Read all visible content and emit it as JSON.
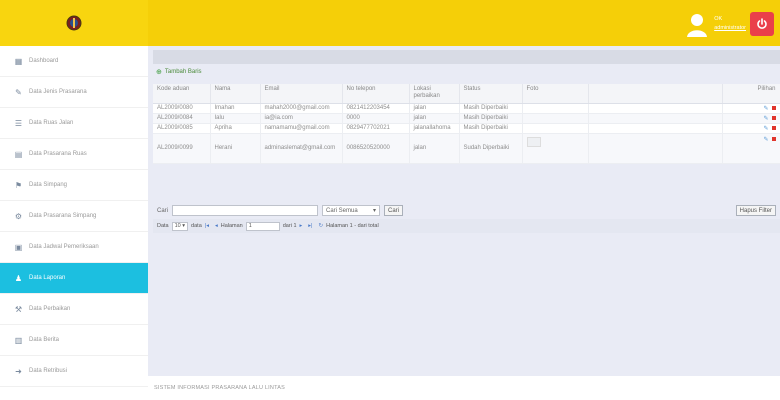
{
  "header": {
    "user_name": "OK",
    "user_role": "administrator",
    "colors": {
      "topbar": "#f5cf08",
      "power": "#ea3f4a",
      "active": "#1cbfe0"
    }
  },
  "sidebar": {
    "items": [
      {
        "label": "Dashboard",
        "icon": "grid-icon"
      },
      {
        "label": "Data Jenis Prasarana",
        "icon": "edit-icon"
      },
      {
        "label": "Data Ruas Jalan",
        "icon": "list-icon"
      },
      {
        "label": "Data Prasarana Ruas",
        "icon": "table-icon"
      },
      {
        "label": "Data Simpang",
        "icon": "flag-icon"
      },
      {
        "label": "Data Prasarana Simpang",
        "icon": "gear-icon"
      },
      {
        "label": "Data Jadwal Pemeriksaan",
        "icon": "calendar-icon"
      },
      {
        "label": "Data Laporan",
        "icon": "users-icon",
        "active": true
      },
      {
        "label": "Data Perbaikan",
        "icon": "wrench-icon"
      },
      {
        "label": "Data Berita",
        "icon": "news-icon"
      },
      {
        "label": "Data Retribusi",
        "icon": "arrow-icon"
      }
    ]
  },
  "grid": {
    "caption": "Tambah Baris",
    "columns": [
      "Kode aduan",
      "Nama",
      "Email",
      "No telepon",
      "Lokasi perbaikan",
      "Status",
      "Foto",
      "",
      "Pilihan"
    ],
    "rows": [
      {
        "kode": "AL2009/0080",
        "nama": "Imahan",
        "email": "mahah2000@gmail.com",
        "telp": "0821412203454",
        "lokasi": "jalan",
        "status": "Masih Diperbaiki"
      },
      {
        "kode": "AL2009/0084",
        "nama": "Ialu",
        "email": "ia@ia.com",
        "telp": "0000",
        "lokasi": "jalan",
        "status": "Masih Diperbaiki"
      },
      {
        "kode": "AL2009/0085",
        "nama": "Apriha",
        "email": "namamamu@gmail.com",
        "telp": "0829477702021",
        "lokasi": "jalanallahoma",
        "status": "Masih Diperbaiki"
      },
      {
        "kode": "AL2009/0099",
        "nama": "Herani",
        "email": "adminaslemat@gmail.com",
        "telp": "0086520520000",
        "lokasi": "jalan",
        "status": "Sudah Diperbaiki"
      }
    ]
  },
  "search": {
    "label": "Cari",
    "scope_selected": "Cari Semua",
    "button": "Cari",
    "reset": "Hapus Filter"
  },
  "pager": {
    "show_label": "Data",
    "per_page": "10",
    "rows_label": "data",
    "page_label": "Halaman",
    "page_value": "1",
    "of_label": "dari 1",
    "info": "Halaman 1 - dari total"
  },
  "footer": {
    "text": "SISTEM INFORMASI PRASARANA LALU LINTAS"
  }
}
